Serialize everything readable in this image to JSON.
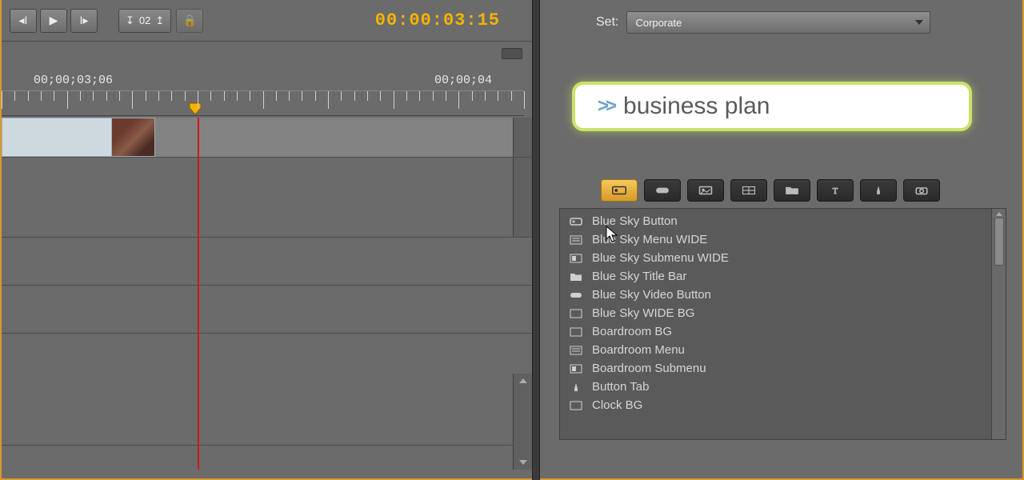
{
  "transport": {
    "step_value": "02",
    "timecode": "00:00:03:15"
  },
  "ruler": {
    "start_label": "00;00;03;06",
    "end_label": "00;00;04",
    "playhead_percent": 37
  },
  "set_row": {
    "label": "Set:",
    "selected": "Corporate"
  },
  "preview": {
    "chevron": ">>",
    "label": "business plan"
  },
  "library": {
    "items": [
      {
        "icon": "button",
        "label": "Blue Sky Button"
      },
      {
        "icon": "menu",
        "label": "Blue Sky Menu WIDE"
      },
      {
        "icon": "submenu",
        "label": "Blue Sky Submenu WIDE"
      },
      {
        "icon": "folder",
        "label": "Blue Sky Title Bar"
      },
      {
        "icon": "pill",
        "label": "Blue Sky Video Button"
      },
      {
        "icon": "bg",
        "label": "Blue Sky WIDE BG"
      },
      {
        "icon": "bg",
        "label": "Boardroom BG"
      },
      {
        "icon": "menu",
        "label": "Boardroom Menu"
      },
      {
        "icon": "submenu",
        "label": "Boardroom Submenu"
      },
      {
        "icon": "tab",
        "label": "Button Tab"
      },
      {
        "icon": "bg",
        "label": "Clock BG"
      }
    ]
  }
}
